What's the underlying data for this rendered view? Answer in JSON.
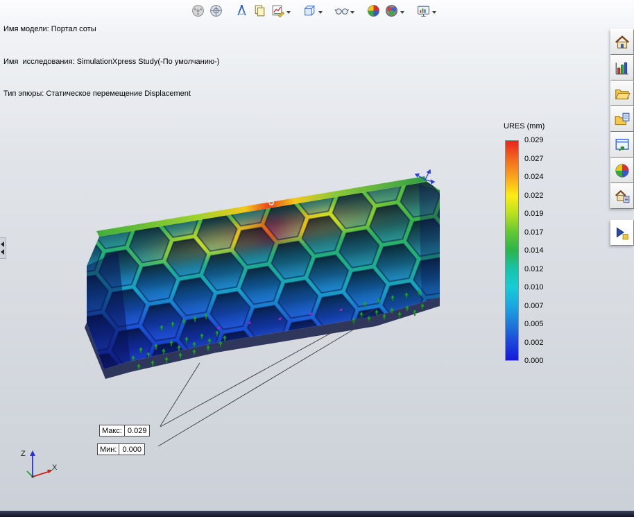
{
  "header": {
    "model_line": "Имя модели: Портал соты",
    "study_line": "Имя  исследования: SimulationXpress Study(-По умолчанию-)",
    "plot_line": "Тип эпюры: Статическое перемещение Displacement"
  },
  "legend": {
    "title": "URES (mm)",
    "values": [
      "0.029",
      "0.027",
      "0.024",
      "0.022",
      "0.019",
      "0.017",
      "0.014",
      "0.012",
      "0.010",
      "0.007",
      "0.005",
      "0.002",
      "0.000"
    ],
    "top_color": "#e8231d",
    "bottom_color": "#1518dd"
  },
  "callouts": {
    "max": {
      "label": "Макс:",
      "value": "0.029"
    },
    "min": {
      "label": "Мин:",
      "value": "0.000"
    }
  },
  "triad": {
    "z_label": "Z",
    "x_label": "X"
  },
  "toolbar": {
    "icons": [
      "iso-clipping-icon",
      "section-clipping-icon",
      "probe-icon",
      "copy-icon",
      "edit-plot-icon",
      "section-view-icon",
      "glasses-icon",
      "color-map-icon",
      "display-options-icon",
      "report-icon"
    ]
  },
  "sidebar": {
    "icons": [
      "home-icon",
      "results-advisor-icon",
      "open-folder-icon",
      "report-folder-icon",
      "window-arrow-icon",
      "color-chart-icon",
      "home-report-icon",
      "export-arrow-icon"
    ]
  }
}
